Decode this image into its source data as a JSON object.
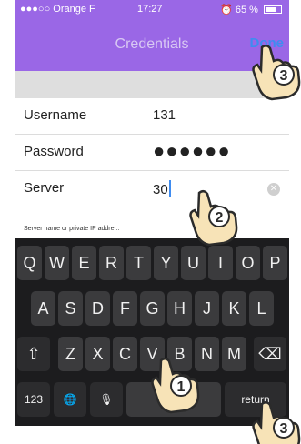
{
  "status_bar": {
    "carrier": "●●●○○ Orange F",
    "wifi": "wifi-icon",
    "time": "17:27",
    "alarm": "alarm-icon",
    "battery_percent": "65 %"
  },
  "nav": {
    "title": "Credentials",
    "done_label": "Done"
  },
  "form": {
    "fields": [
      {
        "label": "Username",
        "value": "131"
      },
      {
        "label": "Password",
        "value": "●●●●●●"
      },
      {
        "label": "Server",
        "value": "30"
      }
    ],
    "hint": "Server name or private IP addre..."
  },
  "keyboard": {
    "row1": [
      "Q",
      "W",
      "E",
      "R",
      "T",
      "Y",
      "U",
      "I",
      "O",
      "P"
    ],
    "row2": [
      "A",
      "S",
      "D",
      "F",
      "G",
      "H",
      "J",
      "K",
      "L"
    ],
    "row3": [
      "Z",
      "X",
      "C",
      "V",
      "B",
      "N",
      "M"
    ],
    "shift_icon": "⇧",
    "backspace_icon": "⌫",
    "numbers_label": "123",
    "globe_icon": "🌐",
    "mic_icon": "🎙",
    "space_label": "space",
    "return_label": "return"
  },
  "annotations": {
    "step_done": "3",
    "step_server": "2",
    "step_keyboard": "1",
    "step_return": "3"
  },
  "colors": {
    "header": "#9a67e6",
    "accent": "#3f8cf0",
    "hand": "#f7e3b7",
    "hand_outline": "#2b2b2b"
  }
}
